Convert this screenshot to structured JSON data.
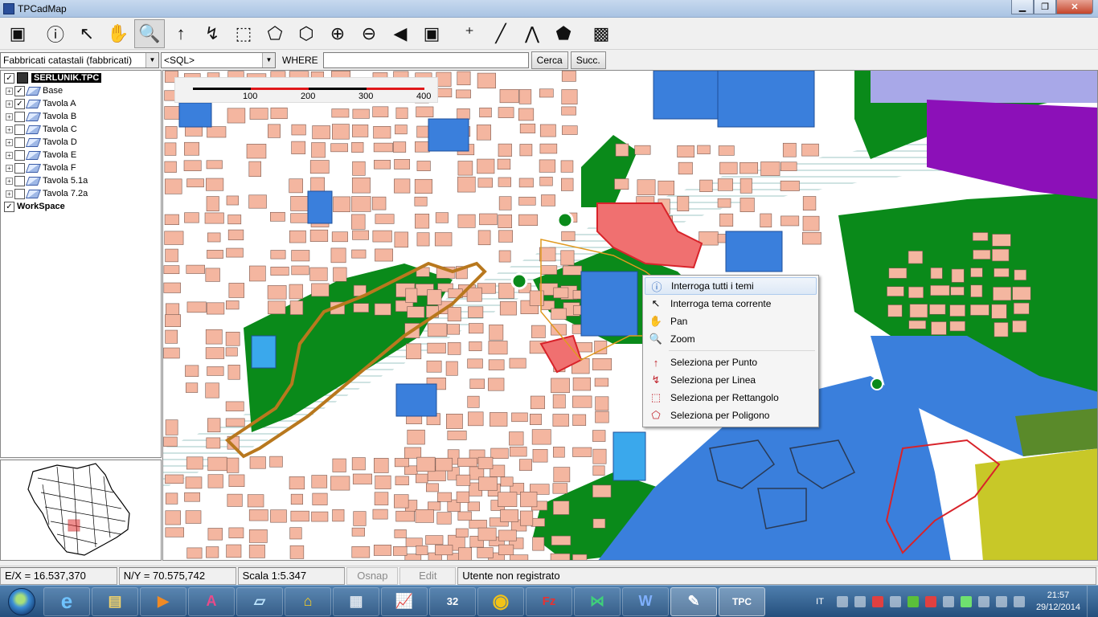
{
  "window": {
    "title": "TPCadMap",
    "minimize": "▁",
    "maximize": "❐",
    "close": "✕"
  },
  "toolbar": {
    "buttons": [
      {
        "name": "open-project-icon",
        "glyph": "▣"
      },
      {
        "name": "info-icon",
        "glyph": "ⓘ"
      },
      {
        "name": "arrow-select-icon",
        "glyph": "↖"
      },
      {
        "name": "pan-hand-icon",
        "glyph": "✋"
      },
      {
        "name": "zoom-icon",
        "glyph": "🔍"
      },
      {
        "name": "select-point-icon",
        "glyph": "↑"
      },
      {
        "name": "select-line-icon",
        "glyph": "↯"
      },
      {
        "name": "select-rectangle-icon",
        "glyph": "⬚"
      },
      {
        "name": "select-polygon-icon",
        "glyph": "⬠"
      },
      {
        "name": "select-polygon-clear-icon",
        "glyph": "⬡"
      },
      {
        "name": "zoom-in-icon",
        "glyph": "⊕"
      },
      {
        "name": "zoom-out-icon",
        "glyph": "⊖"
      },
      {
        "name": "zoom-previous-icon",
        "glyph": "◀"
      },
      {
        "name": "zoom-extent-icon",
        "glyph": "▣"
      },
      {
        "name": "measure-point-icon",
        "glyph": "⁺"
      },
      {
        "name": "measure-line-icon",
        "glyph": "╱"
      },
      {
        "name": "measure-polyline-icon",
        "glyph": "⋀"
      },
      {
        "name": "measure-area-icon",
        "glyph": "⬟"
      },
      {
        "name": "export-cube-icon",
        "glyph": "▩"
      }
    ]
  },
  "querybar": {
    "layer_select": "Fabbricati catastali (fabbricati)",
    "sql_select": "<SQL>",
    "where_label": "WHERE",
    "where_value": "",
    "search_button": "Cerca",
    "next_button": "Succ."
  },
  "layers": {
    "root": "SERLUNIK.TPC",
    "items": [
      {
        "label": "Base",
        "checked": "✓"
      },
      {
        "label": "Tavola A",
        "checked": "✓"
      },
      {
        "label": "Tavola B",
        "checked": ""
      },
      {
        "label": "Tavola C",
        "checked": ""
      },
      {
        "label": "Tavola D",
        "checked": ""
      },
      {
        "label": "Tavola E",
        "checked": ""
      },
      {
        "label": "Tavola F",
        "checked": ""
      },
      {
        "label": "Tavola 5.1a",
        "checked": ""
      },
      {
        "label": "Tavola 7.2a",
        "checked": ""
      }
    ],
    "workspace": "WorkSpace"
  },
  "scalebar": {
    "ticks": [
      "100",
      "200",
      "300",
      "400"
    ]
  },
  "context_menu": {
    "items": [
      {
        "label": "Interroga tutti i temi",
        "icon": "ⓘ"
      },
      {
        "label": "Interroga tema corrente",
        "icon": "↖"
      },
      {
        "label": "Pan",
        "icon": "✋"
      },
      {
        "label": "Zoom",
        "icon": "🔍"
      },
      {
        "label": "Seleziona per Punto",
        "icon": "↑"
      },
      {
        "label": "Seleziona per Linea",
        "icon": "↯"
      },
      {
        "label": "Seleziona per Rettangolo",
        "icon": "⬚"
      },
      {
        "label": "Seleziona per Poligono",
        "icon": "⬠"
      }
    ]
  },
  "statusbar": {
    "ex": "E/X = 16.537,370",
    "ny": "N/Y = 70.575,742",
    "scale": "Scala 1:5.347",
    "osnap": "Osnap",
    "edit": "Edit",
    "user": "Utente non registrato"
  },
  "taskbar": {
    "apps": [
      {
        "name": "internet-explorer-icon",
        "glyph": "e"
      },
      {
        "name": "file-explorer-icon",
        "glyph": "▤"
      },
      {
        "name": "media-player-icon",
        "glyph": "▶"
      },
      {
        "name": "acrobat-icon",
        "glyph": "A"
      },
      {
        "name": "notepad-icon",
        "glyph": "▱"
      },
      {
        "name": "home-app-icon",
        "glyph": "⌂"
      },
      {
        "name": "calculator-icon",
        "glyph": "▦"
      },
      {
        "name": "chart-app-icon",
        "glyph": "📈"
      },
      {
        "name": "win32-app-icon",
        "glyph": "32"
      },
      {
        "name": "chrome-icon",
        "glyph": "◉"
      },
      {
        "name": "filezilla-icon",
        "glyph": "Fz"
      },
      {
        "name": "visual-studio-icon",
        "glyph": "⋈"
      },
      {
        "name": "word-icon",
        "glyph": "W"
      },
      {
        "name": "gimp-icon",
        "glyph": "✎"
      },
      {
        "name": "tpcadmap-icon",
        "glyph": "TPC"
      }
    ],
    "lang": "IT",
    "time": "21:57",
    "date": "29/12/2014"
  },
  "colors": {
    "building": "#f4b6a0",
    "green_area": "#0a8a1a",
    "public": "#3a7fdc",
    "highlight_orange": "#b8781e",
    "red_zone": "#d8232a",
    "purple_zone": "#8c10b8",
    "lavender_zone": "#a8a8e8",
    "olive_zone": "#c8c828"
  }
}
